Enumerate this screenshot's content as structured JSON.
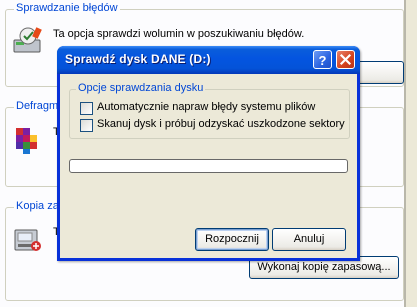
{
  "background": {
    "error_check": {
      "title": "Sprawdzanie błędów",
      "description": "Ta opcja sprawdzi wolumin w poszukiwaniu błędów.",
      "icon": "disk-check-icon"
    },
    "defrag": {
      "title": "Defragmentacja",
      "description": "Ta opcja zdefragmentuje pliki na woluminie.",
      "icon": "defrag-icon"
    },
    "backup": {
      "title": "Kopia zapasowa",
      "description": "Ta opcja wykona kopię zapasową plików na woluminie.",
      "icon": "backup-icon",
      "button_label": "Wykonaj kopię zapasową..."
    }
  },
  "dialog": {
    "title": "Sprawdź dysk DANE (D:)",
    "help_label": "?",
    "close_label": "✕",
    "options_title": "Opcje sprawdzania dysku",
    "options": [
      {
        "label": "Automatycznie napraw błędy systemu plików",
        "checked": false
      },
      {
        "label": "Skanuj dysk i próbuj odzyskać uszkodzone sektory",
        "checked": false
      }
    ],
    "progress_fraction": 0,
    "start_label": "Rozpocznij",
    "cancel_label": "Anuluj"
  },
  "colors": {
    "group_title": "#0046d5",
    "titlebar": "#0454e0",
    "close_button": "#d4421d"
  }
}
